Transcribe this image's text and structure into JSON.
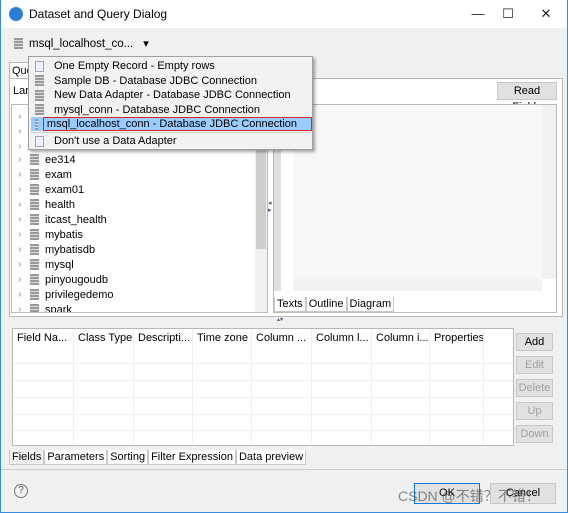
{
  "window": {
    "title": "Dataset and Query Dialog",
    "minimize": "—",
    "maximize": "☐",
    "close": "✕"
  },
  "adapter_select": {
    "value": "msql_localhost_co...",
    "arrow": "▾"
  },
  "query_tab": "Que",
  "language_label": "Lan",
  "read_fields": "Read Fields",
  "tree": {
    "items": [
      "ee314",
      "exam",
      "exam01",
      "health",
      "itcast_health",
      "mybatis",
      "mybatisdb",
      "mysql",
      "pinyougoudb",
      "privilegedemo",
      "spark"
    ]
  },
  "editor_tabs": [
    "Texts",
    "Outline",
    "Diagram"
  ],
  "dropdown": {
    "items": [
      {
        "label": "One Empty Record - Empty rows",
        "icon": "empty-adapter-icon"
      },
      {
        "label": "Sample DB - Database JDBC Connection",
        "icon": "database-icon"
      },
      {
        "label": "New Data Adapter  - Database JDBC Connection",
        "icon": "database-icon"
      },
      {
        "label": "mysql_conn - Database JDBC Connection",
        "icon": "database-icon"
      },
      {
        "label": "msql_localhost_conn - Database JDBC Connection",
        "icon": "database-icon",
        "selected": true
      }
    ],
    "no_adapter": "Don't use a Data Adapter",
    "highlight_color": "#99ccff",
    "annotation_color": "#e0202a"
  },
  "fields_table": {
    "columns": [
      "Field Na...",
      "Class Type",
      "Descripti...",
      "Time zone",
      "Column ...",
      "Column l...",
      "Column i...",
      "Properties"
    ]
  },
  "field_buttons": {
    "add": "Add",
    "edit": "Edit",
    "delete": "Delete",
    "up": "Up",
    "down": "Down"
  },
  "bottom_tabs": [
    "Fields",
    "Parameters",
    "Sorting",
    "Filter Expression",
    "Data preview"
  ],
  "footer": {
    "help": "?",
    "ok": "OK",
    "cancel": "Cancel",
    "watermark": "CSDN @不错？不错！"
  }
}
